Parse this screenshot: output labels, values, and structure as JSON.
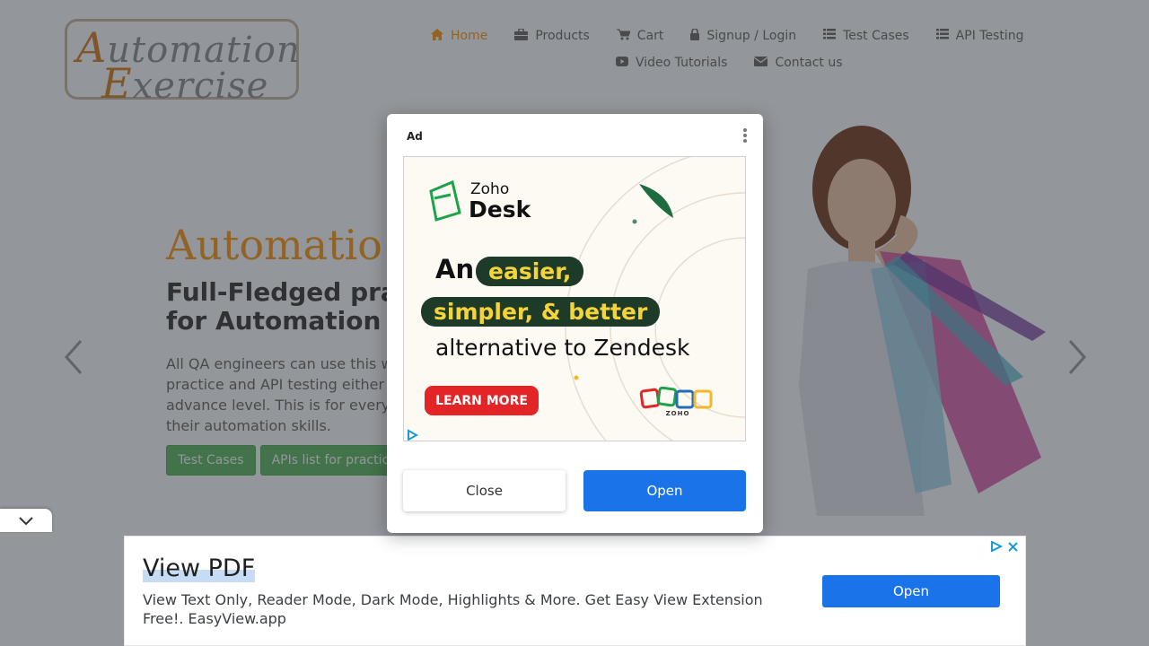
{
  "logo": {
    "line1_cap": "A",
    "line1_rest": "utomation",
    "line2_cap": "E",
    "line2_rest": "xercise"
  },
  "nav": {
    "row1": [
      {
        "label": "Home",
        "icon": "home-icon",
        "glyph": "⌂",
        "active": true
      },
      {
        "label": "Products",
        "icon": "briefcase-icon",
        "glyph": "▣"
      },
      {
        "label": "Cart",
        "icon": "cart-icon",
        "glyph": "🛒"
      },
      {
        "label": "Signup / Login",
        "icon": "lock-icon",
        "glyph": "🔒"
      },
      {
        "label": "Test Cases",
        "icon": "list-icon",
        "glyph": "☰"
      },
      {
        "label": "API Testing",
        "icon": "list-icon",
        "glyph": "☰"
      }
    ],
    "row2": [
      {
        "label": "Video Tutorials",
        "icon": "youtube-icon",
        "glyph": "▶"
      },
      {
        "label": "Contact us",
        "icon": "envelope-icon",
        "glyph": "✉"
      }
    ]
  },
  "hero": {
    "title": "Automatio",
    "subtitle_line1": "Full-Fledged pra",
    "subtitle_line2": "for Automation",
    "text": "All QA engineers can use this w practice and API testing either advance level. This is for every their automation skills.",
    "text_lines": [
      "All QA engineers can use this w",
      "practice and API testing either",
      "advance level. This is for every",
      "their automation skills."
    ],
    "btn_test_cases": "Test Cases",
    "btn_apis": "APIs list for practic"
  },
  "modal": {
    "ad_label": "Ad",
    "creative": {
      "brand_top": "Zoho",
      "brand_bottom": "Desk",
      "line1_word": "An",
      "pill1": "easier,",
      "pill2": "simpler, & better",
      "line3": "alternative to Zendesk",
      "cta": "LEARN MORE",
      "zoho_small": "ZOHO"
    },
    "close_label": "Close",
    "open_label": "Open"
  },
  "bottom_ad": {
    "title": "View PDF",
    "description": "View Text Only, Reader Mode, Dark Mode, Highlights & More. Get Easy View Extension Free!. EasyView.app",
    "open_label": "Open"
  },
  "colors": {
    "accent": "#fe980f",
    "green": "#5cb85c",
    "blue": "#1a73e8"
  }
}
